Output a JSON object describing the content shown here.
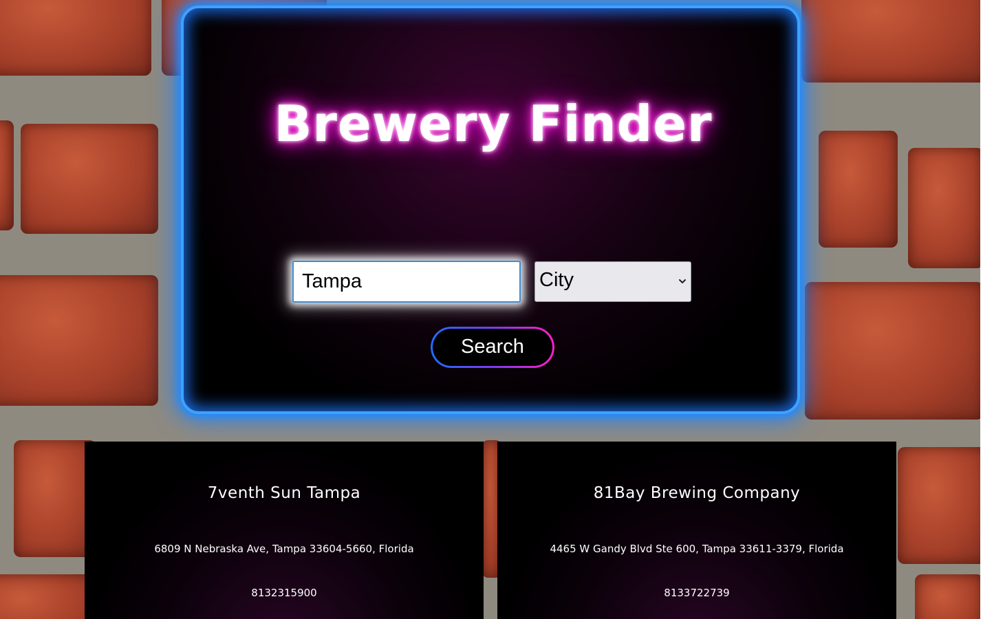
{
  "app": {
    "title": "Brewery Finder"
  },
  "search": {
    "query_value": "Tampa",
    "filter_selected": "City",
    "button_label": "Search"
  },
  "results": [
    {
      "name": "7venth Sun Tampa",
      "address": "6809 N Nebraska Ave, Tampa 33604-5660, Florida",
      "phone": "8132315900"
    },
    {
      "name": "81Bay Brewing Company",
      "address": "4465 W Gandy Blvd Ste 600, Tampa 33611-3379, Florida",
      "phone": "8133722739"
    }
  ],
  "colors": {
    "panel_border": "#3da2ff",
    "title_glow": "#e200c8",
    "button_gradient_start": "#1f6bff",
    "button_gradient_end": "#ff1fc7"
  }
}
